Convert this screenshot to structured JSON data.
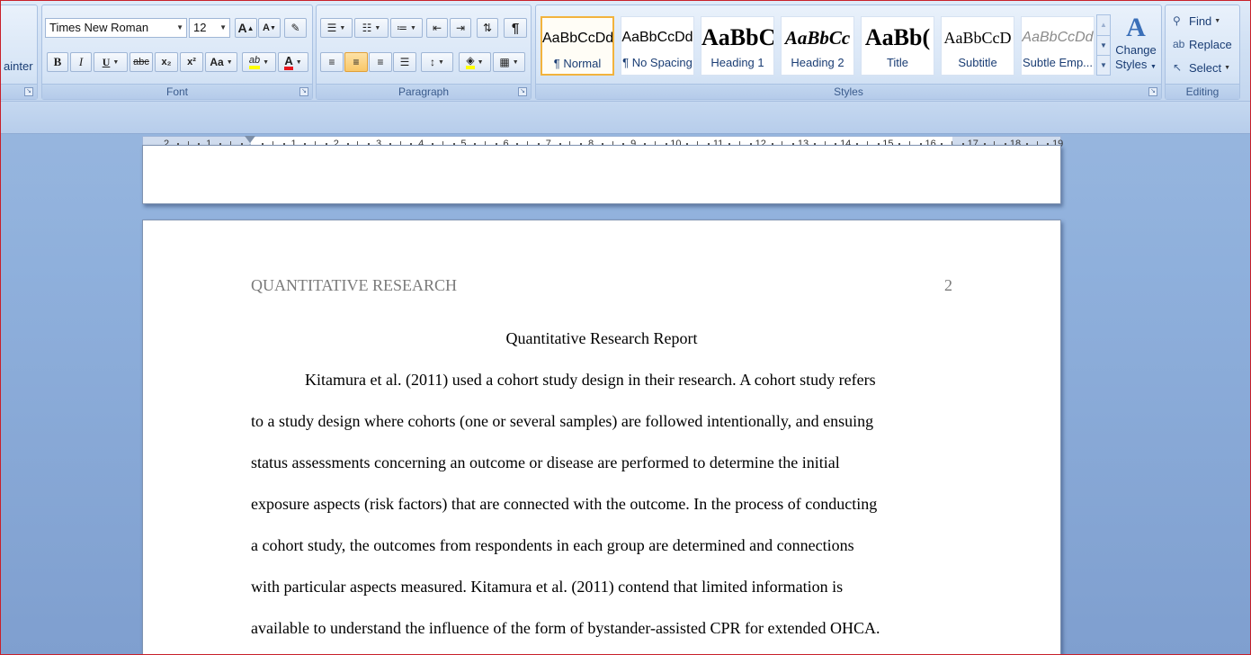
{
  "ribbon": {
    "clipboard": {
      "format_painter_partial": "ainter"
    },
    "font": {
      "group_label": "Font",
      "font_name": "Times New Roman",
      "font_size": "12",
      "grow_font": "A",
      "shrink_font": "A",
      "clear_format_glyph": "✎",
      "bold": "B",
      "italic": "I",
      "underline": "U",
      "strikethrough": "abc",
      "subscript": "x₂",
      "superscript": "x²",
      "change_case": "Aa",
      "highlight": "ab",
      "font_color": "A"
    },
    "paragraph": {
      "group_label": "Paragraph",
      "show_hide": "¶"
    },
    "styles": {
      "group_label": "Styles",
      "tiles": [
        {
          "sample": "AaBbCcDd",
          "name": "¶ Normal"
        },
        {
          "sample": "AaBbCcDd",
          "name": "¶ No Spacing"
        },
        {
          "sample": "AaBbC(",
          "name": "Heading 1"
        },
        {
          "sample": "AaBbCc",
          "name": "Heading 2"
        },
        {
          "sample": "AaBb(",
          "name": "Title"
        },
        {
          "sample": "AaBbCcD",
          "name": "Subtitle"
        },
        {
          "sample": "AaBbCcDd",
          "name": "Subtle Emp..."
        }
      ],
      "change_styles_line1": "Change",
      "change_styles_line2": "Styles"
    },
    "editing": {
      "group_label": "Editing",
      "find": "Find",
      "replace": "Replace",
      "select": "Select"
    }
  },
  "ruler": {
    "labels": [
      "2",
      "1",
      "",
      "1",
      "2",
      "3",
      "4",
      "5",
      "6",
      "7",
      "8",
      "9",
      "10",
      "11",
      "12",
      "13",
      "14",
      "15",
      "16",
      "17",
      "18",
      "19"
    ]
  },
  "document": {
    "running_head": "QUANTITATIVE RESEARCH",
    "page_number": "2",
    "title": "Quantitative Research Report",
    "lines": [
      "Kitamura et al. (2011) used a cohort study design in their research. A cohort study refers",
      "to a study design where cohorts (one or several samples) are followed intentionally, and ensuing",
      "status assessments concerning an outcome or disease are performed to determine the initial",
      "exposure aspects (risk factors) that are connected with the outcome. In the process of conducting",
      "a cohort study, the outcomes from respondents in each group are determined and connections",
      "with particular aspects measured. Kitamura et al. (2011) contend that limited information is",
      "available to understand the influence of the form of bystander-assisted CPR for extended OHCA."
    ]
  },
  "colors": {
    "highlight_bar": "#ffff00",
    "font_color_bar": "#e8161e",
    "selected_style_border": "#f2b33d",
    "window_border": "#c8202a"
  }
}
